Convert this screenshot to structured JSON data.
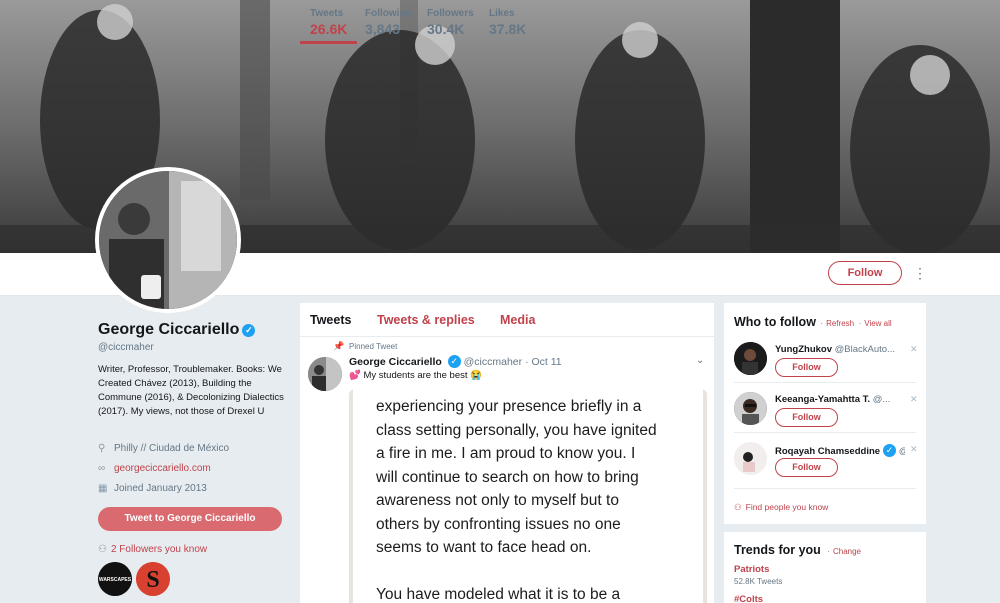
{
  "profile": {
    "name": "George Ciccariello",
    "handle": "@ciccmaher",
    "bio": "Writer, Professor, Troublemaker. Books: We Created Chávez (2013), Building the Commune (2016), & Decolonizing Dialectics (2017). My views, not those of Drexel U",
    "location": "Philly // Ciudad de México",
    "website": "georgeciccariello.com",
    "joined": "Joined January 2013",
    "tweet_to": "Tweet to George Ciccariello",
    "followers_you_know": "2 Followers you know",
    "mini_avatar_1": "WARSCAPES",
    "mini_avatar_2": "S"
  },
  "stats": [
    {
      "label": "Tweets",
      "value": "26.6K"
    },
    {
      "label": "Following",
      "value": "3,843"
    },
    {
      "label": "Followers",
      "value": "30.4K"
    },
    {
      "label": "Likes",
      "value": "37.8K"
    }
  ],
  "follow_button": "Follow",
  "timeline": {
    "tabs": [
      "Tweets",
      "Tweets & replies",
      "Media"
    ],
    "pinned_label": "Pinned Tweet",
    "tweet": {
      "author": "George Ciccariello",
      "handle": "@ciccmaher",
      "date": "Oct 11",
      "text": "My students are the best",
      "image_text": "experiencing your presence briefly in a\nclass setting personally, you have ignited\na fire in me.  I am proud to know you.  I\nwill continue to search on how to bring\nawareness not only to myself but to\nothers by confronting issues no one\nseems to want to face head on.\n\nYou have modeled what it is to be a"
    }
  },
  "who_to_follow": {
    "title": "Who to follow",
    "refresh": "Refresh",
    "view_all": "View all",
    "suggestions": [
      {
        "name": "YungZhukov",
        "handle": "@BlackAuto...",
        "follow": "Follow"
      },
      {
        "name": "Keeanga-Yamahtta T.",
        "handle": "@...",
        "follow": "Follow"
      },
      {
        "name": "Roqayah Chamseddine",
        "handle": "@",
        "follow": "Follow"
      }
    ],
    "find_people": "Find people you know"
  },
  "trends": {
    "title": "Trends for you",
    "change": "Change",
    "items": [
      {
        "name": "Patriots",
        "count": "52.8K Tweets"
      },
      {
        "name": "#Colts"
      }
    ]
  },
  "colors": {
    "accent": "#c0424b",
    "verified": "#1da1f2",
    "background": "#e6ecf0"
  }
}
